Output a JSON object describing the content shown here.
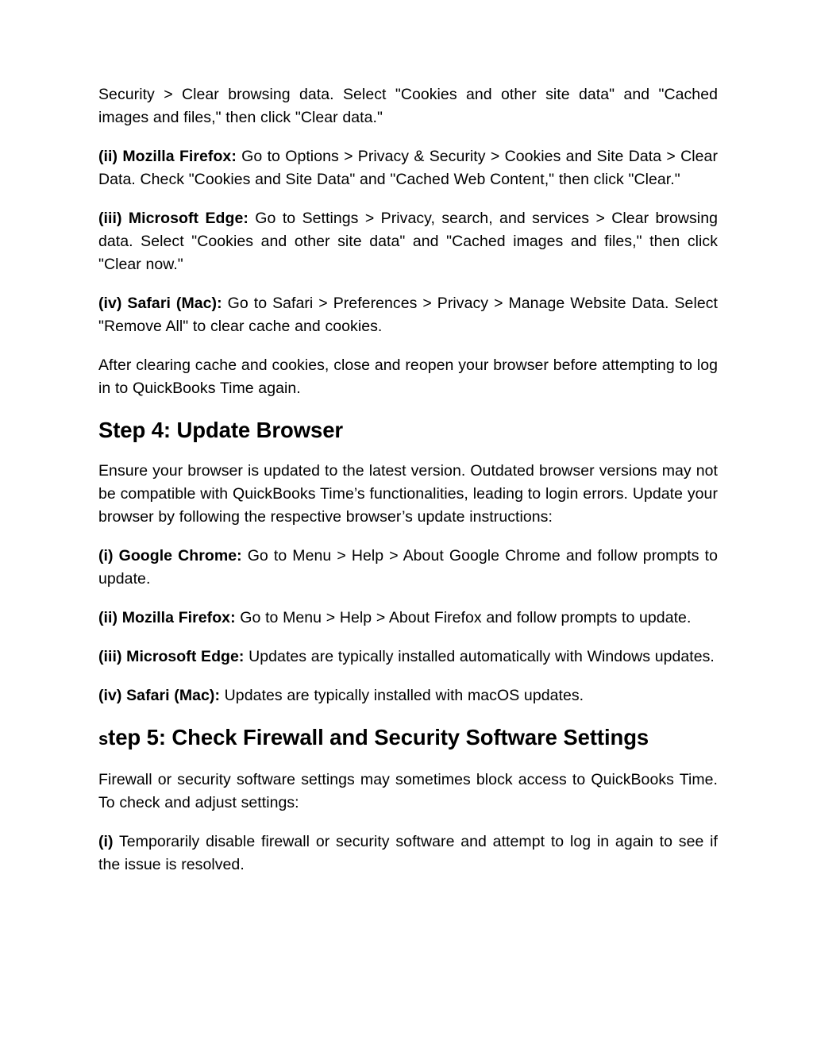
{
  "document": {
    "background_color": "#ffffff",
    "text_color": "#000000",
    "blocks": {
      "p_chrome_tail": {
        "text": "Security > Clear browsing data. Select \"Cookies and other site data\" and \"Cached images and files,\" then click \"Clear data.\""
      },
      "p_firefox_cache": {
        "label": "(ii) Mozilla Firefox:",
        "text": " Go to Options > Privacy & Security > Cookies and Site Data > Clear Data. Check \"Cookies and Site Data\" and \"Cached Web Content,\" then click \"Clear.\""
      },
      "p_edge_cache": {
        "label": "(iii) Microsoft Edge:",
        "text": " Go to Settings > Privacy, search, and services > Clear browsing data. Select \"Cookies and other site data\" and \"Cached images and files,\" then click \"Clear now.\""
      },
      "p_safari_cache": {
        "label": "(iv) Safari (Mac):",
        "text": " Go to Safari > Preferences > Privacy > Manage Website Data. Select \"Remove All\" to clear cache and cookies."
      },
      "p_after_clearing": {
        "text": "After clearing cache and cookies, close and reopen your browser before attempting to log in to QuickBooks Time again."
      },
      "h_step4": {
        "text": "Step 4: Update Browser"
      },
      "p_step4_intro": {
        "text": "Ensure your browser is updated to the latest version. Outdated browser versions may not be compatible with QuickBooks Time’s functionalities, leading to login errors. Update your browser by following the respective browser’s update instructions:"
      },
      "p_chrome_update": {
        "label": "(i) Google Chrome:",
        "text": " Go to Menu > Help > About Google Chrome and follow prompts to update."
      },
      "p_firefox_update": {
        "label": "(ii) Mozilla Firefox:",
        "text": " Go to Menu > Help > About Firefox and follow prompts to update."
      },
      "p_edge_update": {
        "label": "(iii) Microsoft Edge:",
        "text": " Updates are typically installed automatically with Windows updates."
      },
      "p_safari_update": {
        "label": "(iv) Safari (Mac):",
        "text": " Updates are typically installed with macOS updates."
      },
      "h_step5": {
        "lead": "s",
        "rest": "tep 5: Check Firewall and Security Software Settings"
      },
      "p_step5_intro": {
        "text": "Firewall or security software settings may sometimes block access to QuickBooks Time. To check and adjust settings:"
      },
      "p_step5_item1": {
        "label": "(i)",
        "text": " Temporarily disable firewall or security software and attempt to log in again to see if the issue is resolved."
      }
    }
  }
}
